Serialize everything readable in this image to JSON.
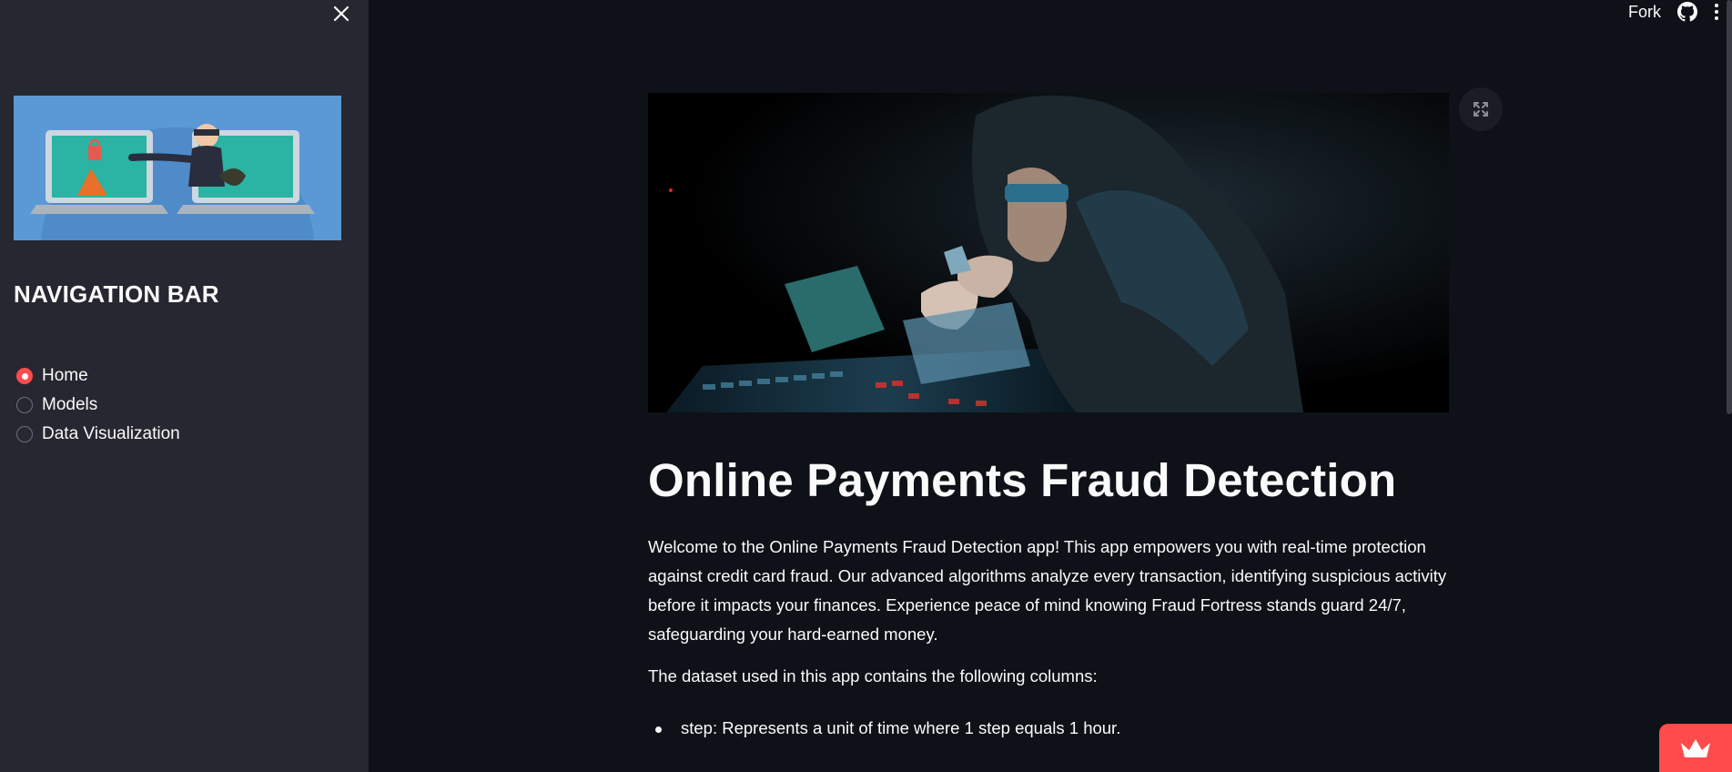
{
  "sidebar": {
    "nav_title": "NAVIGATION BAR",
    "nav_options": [
      {
        "label": "Home",
        "selected": true
      },
      {
        "label": "Models",
        "selected": false
      },
      {
        "label": "Data Visualization",
        "selected": false
      }
    ]
  },
  "topbar": {
    "fork_label": "Fork"
  },
  "main": {
    "title": "Online Payments Fraud Detection",
    "intro": "Welcome to the Online Payments Fraud Detection app! This app empowers you with real-time protection against credit card fraud. Our advanced algorithms analyze every transaction, identifying suspicious activity before it impacts your finances. Experience peace of mind knowing Fraud Fortress stands guard 24/7, safeguarding your hard-earned money.",
    "dataset_intro": "The dataset used in this app contains the following columns:",
    "columns": [
      "step: Represents a unit of time where 1 step equals 1 hour."
    ]
  },
  "colors": {
    "background": "#0e1117",
    "sidebar": "#262730",
    "accent": "#ff4b4b",
    "text": "#fafafa"
  }
}
